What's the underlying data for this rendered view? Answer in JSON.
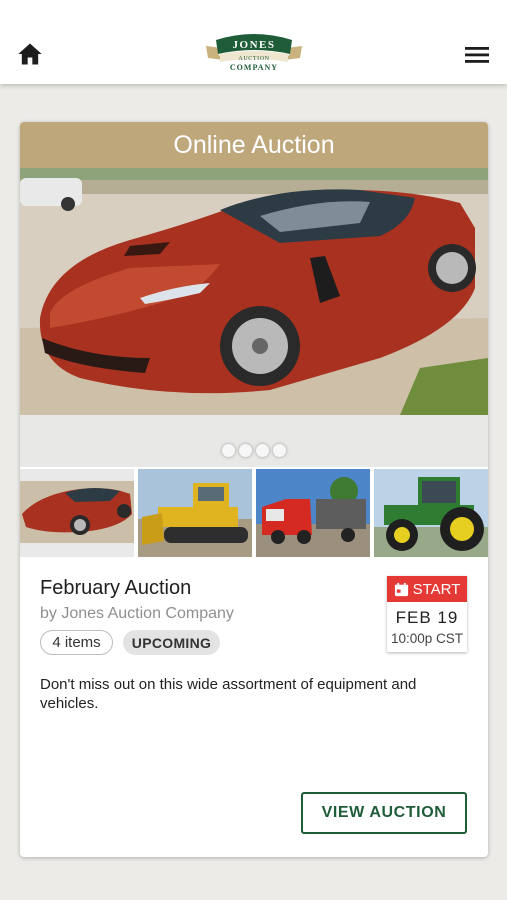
{
  "header": {
    "logo": {
      "line1": "JONES",
      "line2": "AUCTION",
      "line3": "COMPANY"
    },
    "home_icon": "home-icon",
    "menu_icon": "hamburger-menu-icon"
  },
  "card": {
    "header_label": "Online Auction",
    "carousel_dots": 4,
    "thumbnails": [
      "red sports car",
      "yellow bulldozer",
      "red semi truck",
      "green tractor"
    ],
    "title": "February Auction",
    "byline": "by Jones Auction Company",
    "items_badge": "4 items",
    "status_badge": "UPCOMING",
    "date": {
      "label": "START",
      "day": "FEB 19",
      "time": "10:00p CST"
    },
    "description": "Don't miss out on this wide assortment of equipment and vehicles.",
    "button_label": "VIEW AUCTION"
  },
  "colors": {
    "header_gold": "#bfa77c",
    "brand_green": "#1f5c38",
    "start_red": "#e53935"
  }
}
